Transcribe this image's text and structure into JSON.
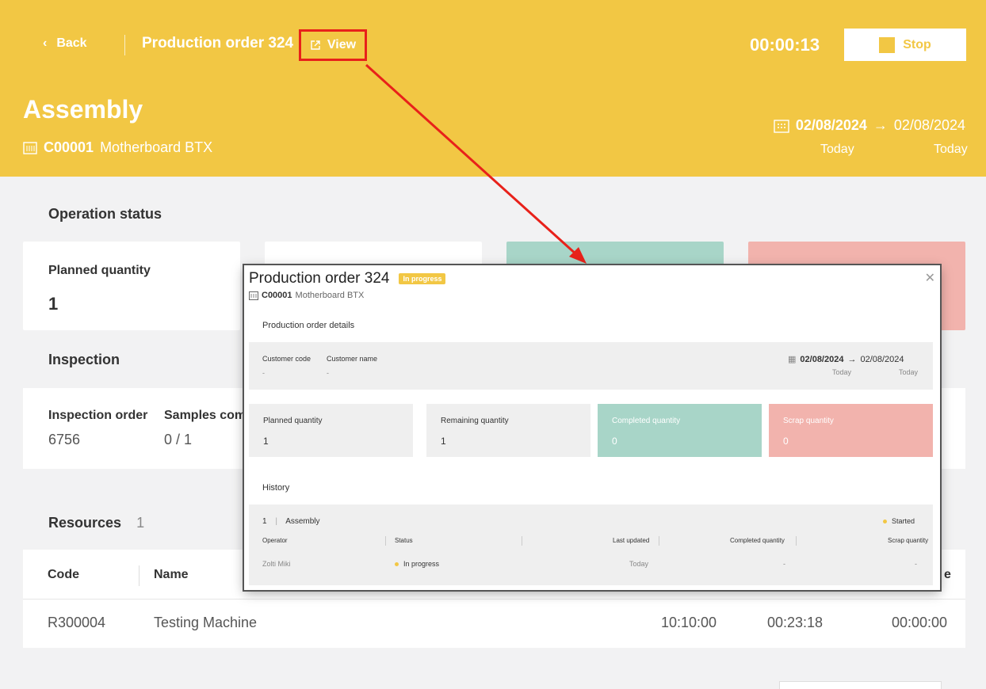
{
  "header": {
    "back_label": "Back",
    "order_title": "Production order 324",
    "view_label": "View",
    "timer": "00:00:13",
    "stop_label": "Stop",
    "operation": "Assembly",
    "product_code": "C00001",
    "product_name": "Motherboard BTX",
    "start_date": "02/08/2024",
    "end_date": "02/08/2024",
    "start_rel": "Today",
    "end_rel": "Today"
  },
  "operation_status": {
    "title": "Operation status",
    "planned_label": "Planned quantity",
    "planned_value": "1"
  },
  "inspection": {
    "title": "Inspection",
    "order_label": "Inspection order",
    "order_value": "6756",
    "samples_label": "Samples comp",
    "samples_value": "0 / 1"
  },
  "resources": {
    "title": "Resources",
    "count": "1",
    "columns": [
      "Code",
      "Name",
      "e"
    ],
    "rows": [
      {
        "code": "R300004",
        "name": "Testing Machine",
        "t1": "10:10:00",
        "t2": "00:23:18",
        "t3": "00:00:00"
      }
    ]
  },
  "modal": {
    "title": "Production order 324",
    "status_badge": "In progress",
    "product_code": "C00001",
    "product_name": "Motherboard BTX",
    "details_title": "Production order details",
    "customer_code_label": "Customer code",
    "customer_code_value": "-",
    "customer_name_label": "Customer name",
    "customer_name_value": "-",
    "start_date": "02/08/2024",
    "end_date": "02/08/2024",
    "start_rel": "Today",
    "end_rel": "Today",
    "quantities": [
      {
        "label": "Planned quantity",
        "value": "1"
      },
      {
        "label": "Remaining quantity",
        "value": "1"
      },
      {
        "label": "Completed quantity",
        "value": "0"
      },
      {
        "label": "Scrap quantity",
        "value": "0"
      }
    ],
    "history_title": "History",
    "history": {
      "step": "1",
      "operation": "Assembly",
      "state": "Started",
      "columns": [
        "Operator",
        "Status",
        "Last updated",
        "Completed quantity",
        "Scrap quantity"
      ],
      "row": {
        "operator": "Zolti Miki",
        "status": "In progress",
        "last_updated": "Today",
        "completed": "-",
        "scrap": "-"
      }
    }
  },
  "colors": {
    "brand": "#f2c744",
    "completed": "#a8d5c8",
    "scrap": "#f2b3ad",
    "highlight": "#e8211a"
  }
}
